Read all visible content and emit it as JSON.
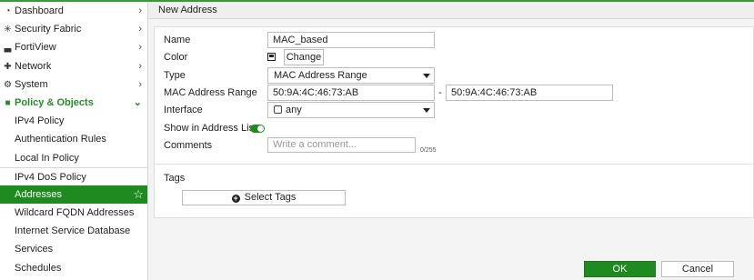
{
  "sidebar": {
    "items": [
      {
        "label": "Dashboard",
        "icon": "dashboard-icon",
        "glyph": "◔"
      },
      {
        "label": "Security Fabric",
        "icon": "security-fabric-icon",
        "glyph": "✳"
      },
      {
        "label": "FortiView",
        "icon": "fortiview-icon",
        "glyph": "▃"
      },
      {
        "label": "Network",
        "icon": "network-icon",
        "glyph": "✚"
      },
      {
        "label": "System",
        "icon": "system-icon",
        "glyph": "⚙"
      },
      {
        "label": "Policy & Objects",
        "icon": "policy-objects-icon",
        "glyph": "■"
      }
    ],
    "subitems": [
      "IPv4 Policy",
      "Authentication Rules",
      "Local In Policy",
      "IPv4 DoS Policy",
      "Addresses",
      "Wildcard FQDN Addresses",
      "Internet Service Database",
      "Services",
      "Schedules"
    ],
    "active": "Addresses"
  },
  "header": {
    "title": "New Address"
  },
  "form": {
    "name_label": "Name",
    "name_value": "MAC_based",
    "color_label": "Color",
    "color_button": "Change",
    "type_label": "Type",
    "type_value": "MAC Address Range",
    "mac_label": "MAC Address Range",
    "mac_start": "50:9A:4C:46:73:AB",
    "mac_separator": "-",
    "mac_end": "50:9A:4C:46:73:AB",
    "interface_label": "Interface",
    "interface_value": "any",
    "show_label": "Show in Address List",
    "show_enabled": true,
    "comments_label": "Comments",
    "comments_placeholder": "Write a comment...",
    "comments_counter": "0/255",
    "tags_label": "Tags",
    "tags_button": "Select Tags"
  },
  "footer": {
    "ok": "OK",
    "cancel": "Cancel"
  },
  "colors": {
    "accent": "#1f8a1f",
    "section": "#2a8a2a"
  }
}
